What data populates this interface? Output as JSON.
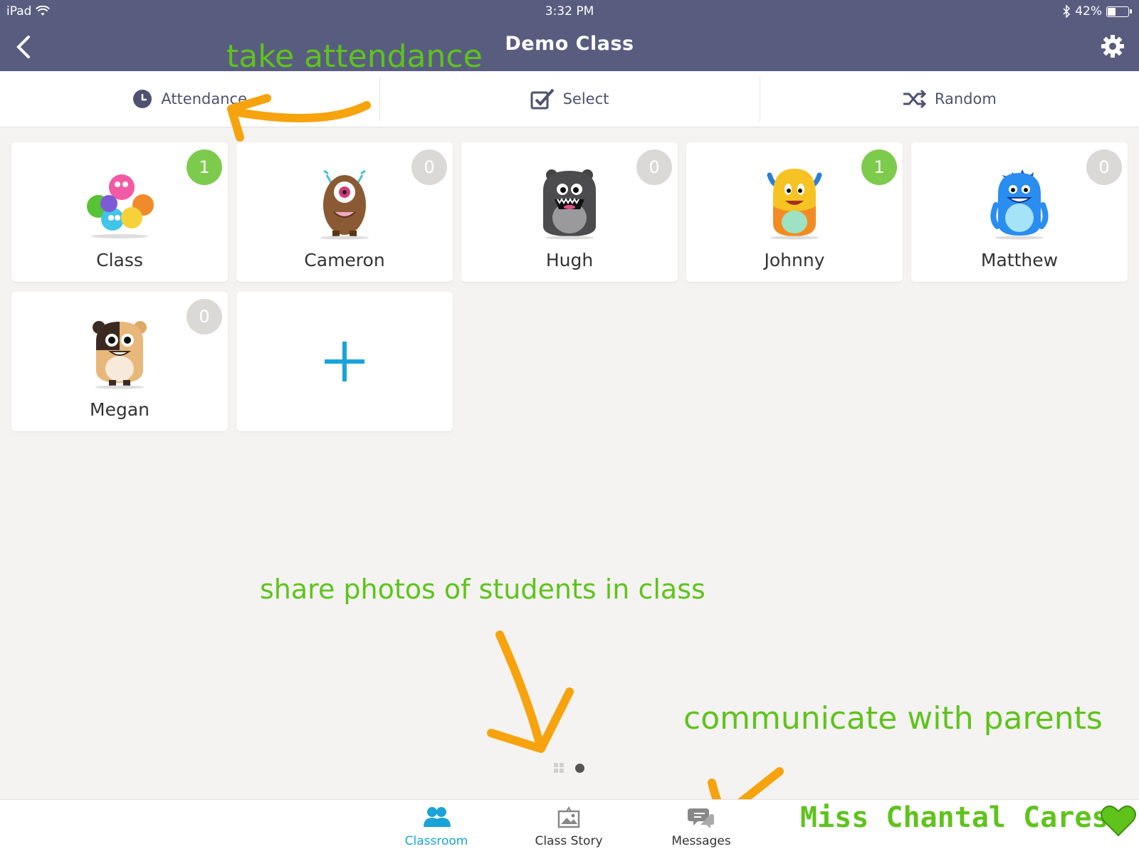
{
  "status_bar": {
    "device": "iPad",
    "time": "3:32 PM",
    "battery": "42%",
    "battery_level": 0.42
  },
  "nav": {
    "title": "Demo Class",
    "back_icon": "chevron-left-icon",
    "settings_icon": "gear-icon"
  },
  "toolbar": [
    {
      "label": "Attendance",
      "icon": "clock-icon"
    },
    {
      "label": "Select",
      "icon": "checkbox-icon"
    },
    {
      "label": "Random",
      "icon": "shuffle-icon"
    }
  ],
  "cards": [
    {
      "name": "Class",
      "points": "1",
      "badge_active": true
    },
    {
      "name": "Cameron",
      "points": "0",
      "badge_active": false
    },
    {
      "name": "Hugh",
      "points": "0",
      "badge_active": false
    },
    {
      "name": "Johnny",
      "points": "1",
      "badge_active": true
    },
    {
      "name": "Matthew",
      "points": "0",
      "badge_active": false
    },
    {
      "name": "Megan",
      "points": "0",
      "badge_active": false
    }
  ],
  "add_card": {
    "icon": "plus-icon"
  },
  "tabbar": [
    {
      "label": "Classroom",
      "icon": "users-icon",
      "active": true
    },
    {
      "label": "Class Story",
      "icon": "photo-icon",
      "active": false
    },
    {
      "label": "Messages",
      "icon": "chat-bubbles-icon",
      "active": false
    }
  ],
  "annotations": {
    "take_attendance": "take attendance",
    "share_photos": "share photos of students in class",
    "communicate": "communicate with parents",
    "signature": "Miss Chantal Cares"
  },
  "colors": {
    "nav_bg": "#585d80",
    "annotation_green": "#5fc31c",
    "arrow_orange": "#f7a30e",
    "badge_green": "#7dcb4c",
    "badge_grey": "#dad9d6",
    "accent_blue": "#1aa3d9"
  }
}
